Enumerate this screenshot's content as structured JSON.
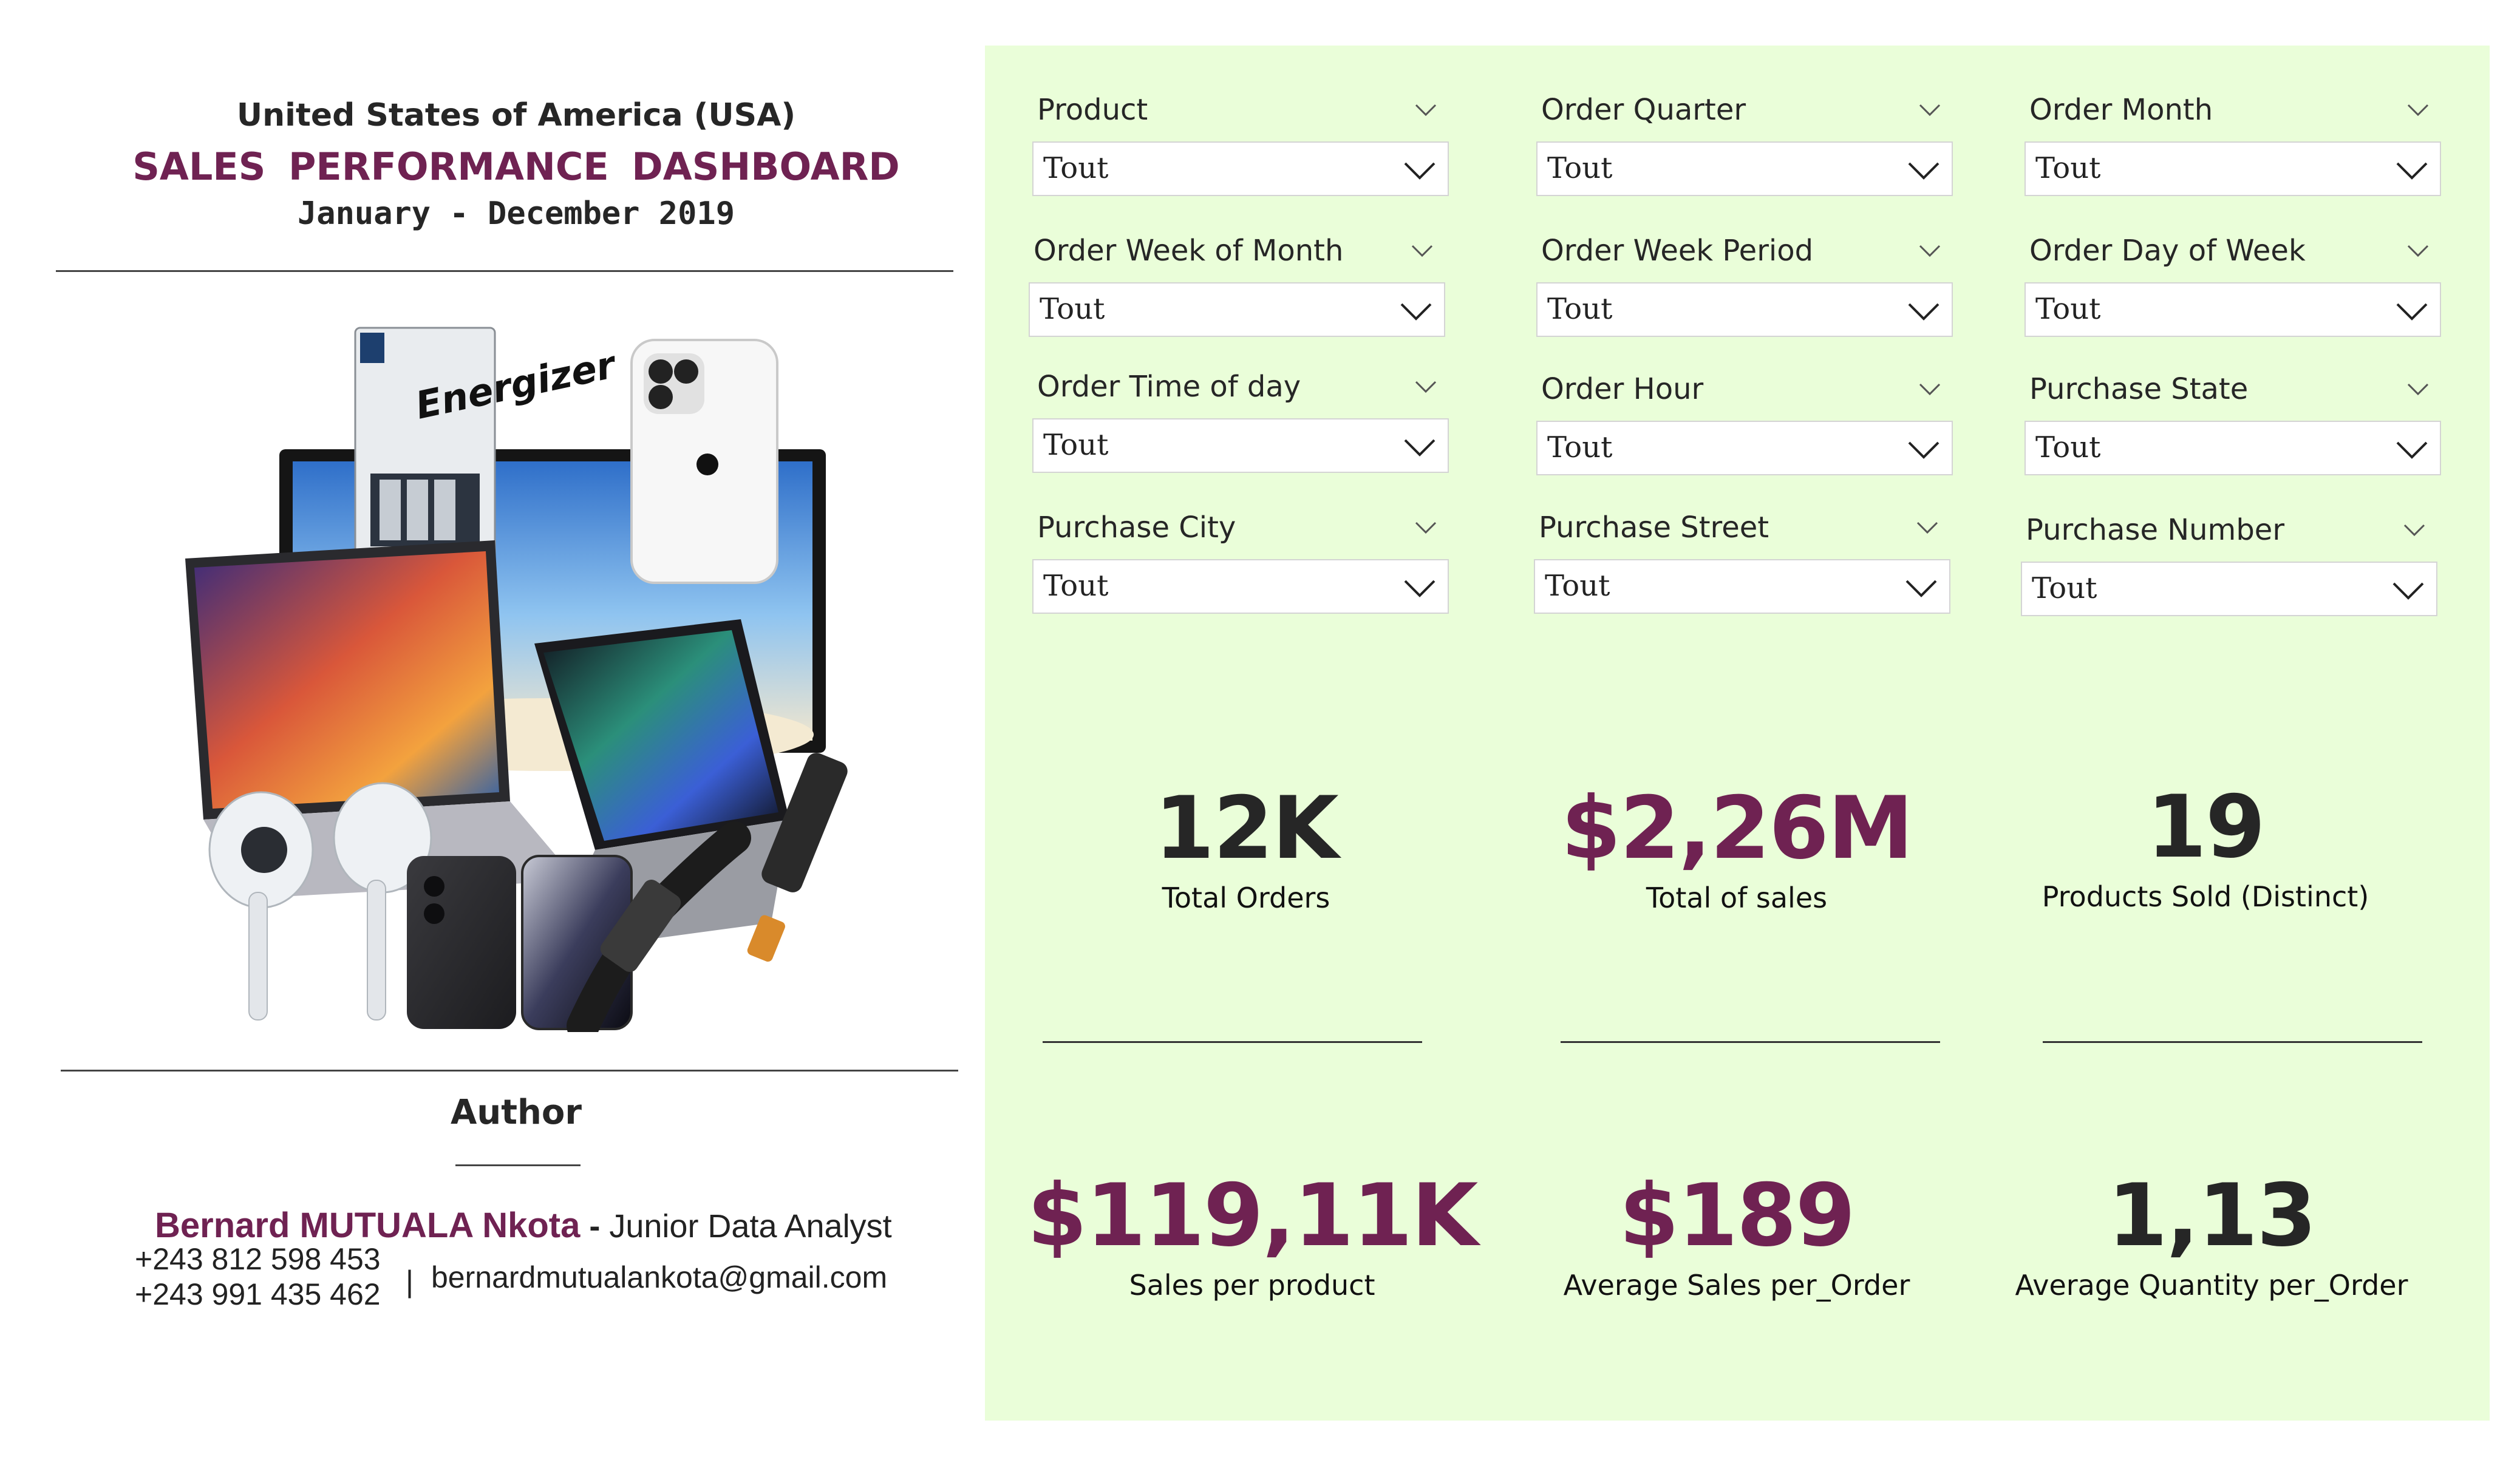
{
  "header": {
    "country": "United States of America (USA)",
    "title": "SALES  PERFORMANCE  DASHBOARD",
    "period": "January - December 2019"
  },
  "author": {
    "label": "Author",
    "name": "Bernard MUTUALA Nkota",
    "separator": " - ",
    "role": "Junior Data Analyst",
    "phone1": "+243 812 598 453",
    "phone2": "+243 991 435 462",
    "divider": "|",
    "email": "bernardmutualankota@gmail.com"
  },
  "slicers": [
    {
      "title": "Product",
      "value": "Tout"
    },
    {
      "title": "Order Quarter",
      "value": "Tout"
    },
    {
      "title": "Order Month",
      "value": "Tout"
    },
    {
      "title": "Order Week of Month",
      "value": "Tout"
    },
    {
      "title": "Order Week Period",
      "value": "Tout"
    },
    {
      "title": "Order Day of Week",
      "value": "Tout"
    },
    {
      "title": "Order Time of day",
      "value": "Tout"
    },
    {
      "title": "Order Hour",
      "value": "Tout"
    },
    {
      "title": "Purchase State",
      "value": "Tout"
    },
    {
      "title": "Purchase City",
      "value": "Tout"
    },
    {
      "title": "Purchase Street",
      "value": "Tout"
    },
    {
      "title": "Purchase Number",
      "value": "Tout"
    }
  ],
  "kpis": [
    {
      "value": "12K",
      "label": "Total Orders"
    },
    {
      "value": "$2,26M",
      "label": "Total of sales"
    },
    {
      "value": "19",
      "label": "Products Sold (Distinct)"
    },
    {
      "value": "$119,11K",
      "label": "Sales per product"
    },
    {
      "value": "$189",
      "label": "Average Sales per_Order"
    },
    {
      "value": "1,13",
      "label": "Average Quantity per_Order"
    }
  ],
  "colors": {
    "accent": "#6f2252",
    "panel_bg": "#eafed9",
    "text": "#262626"
  }
}
